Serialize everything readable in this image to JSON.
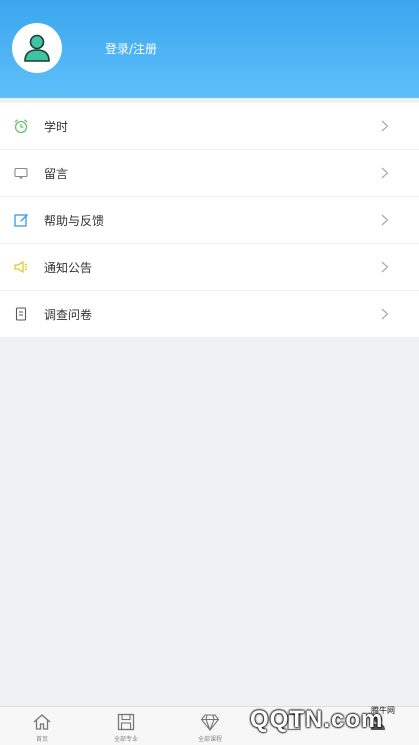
{
  "profile": {
    "login_label": "登录/注册"
  },
  "menu": [
    {
      "label": "学时",
      "icon": "alarm-clock-icon"
    },
    {
      "label": "留言",
      "icon": "message-icon"
    },
    {
      "label": "帮助与反馈",
      "icon": "edit-icon"
    },
    {
      "label": "通知公告",
      "icon": "megaphone-icon"
    },
    {
      "label": "调查问卷",
      "icon": "document-icon"
    }
  ],
  "tabs": [
    {
      "label": "首页",
      "icon": "home-icon"
    },
    {
      "label": "全部专业",
      "icon": "floppy-icon"
    },
    {
      "label": "全部课程",
      "icon": "diamond-icon"
    },
    {
      "label": "",
      "icon": "book-icon"
    },
    {
      "label": "",
      "icon": "profile-icon"
    }
  ],
  "watermark": {
    "text": "QQTN.com",
    "small": "腾牛网"
  },
  "colors": {
    "header_top": "#3aa6ee",
    "header_bottom": "#5ec0fa",
    "accent_green": "#2eb88a"
  }
}
